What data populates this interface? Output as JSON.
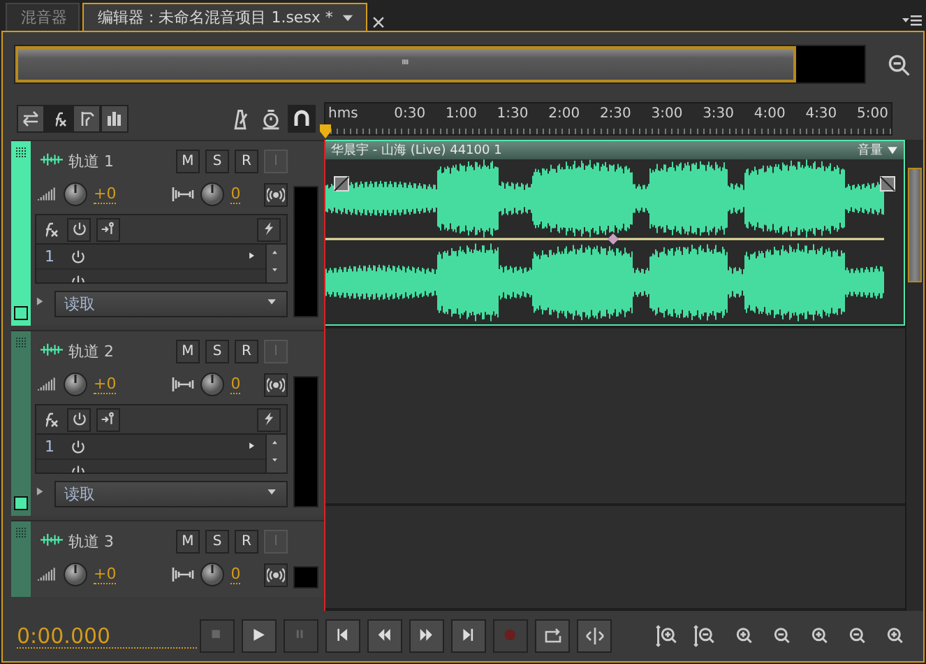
{
  "tabs": [
    {
      "label": "混音器",
      "selected": false
    },
    {
      "label": "编辑器 : 未命名混音项目 1.sesx *",
      "selected": true
    }
  ],
  "ruler": [
    "hms",
    "0:30",
    "1:00",
    "1:30",
    "2:00",
    "2:30",
    "3:00",
    "3:30",
    "4:00",
    "4:30",
    "5:00"
  ],
  "tracks": [
    {
      "name": "轨道 1",
      "selected": true,
      "buttons": [
        {
          "label": "M",
          "disabled": false
        },
        {
          "label": "S",
          "disabled": false
        },
        {
          "label": "R",
          "disabled": false
        },
        {
          "label": "I",
          "disabled": true
        }
      ],
      "volume": "+0",
      "pan": "0",
      "fx_slots": [
        "1"
      ],
      "automation": "读取"
    },
    {
      "name": "轨道 2",
      "selected": false,
      "buttons": [
        {
          "label": "M",
          "disabled": false
        },
        {
          "label": "S",
          "disabled": false
        },
        {
          "label": "R",
          "disabled": false
        },
        {
          "label": "I",
          "disabled": true
        }
      ],
      "volume": "+0",
      "pan": "0",
      "fx_slots": [
        "1"
      ],
      "automation": "读取"
    },
    {
      "name": "轨道 3",
      "selected": false,
      "buttons": [
        {
          "label": "M",
          "disabled": false
        },
        {
          "label": "S",
          "disabled": false
        },
        {
          "label": "R",
          "disabled": false
        },
        {
          "label": "I",
          "disabled": true
        }
      ],
      "volume": "+0",
      "pan": "0"
    }
  ],
  "clip": {
    "title": "华晨宇 - 山海 (Live) 44100 1",
    "envelope": "音量"
  },
  "time": "0:00.000"
}
